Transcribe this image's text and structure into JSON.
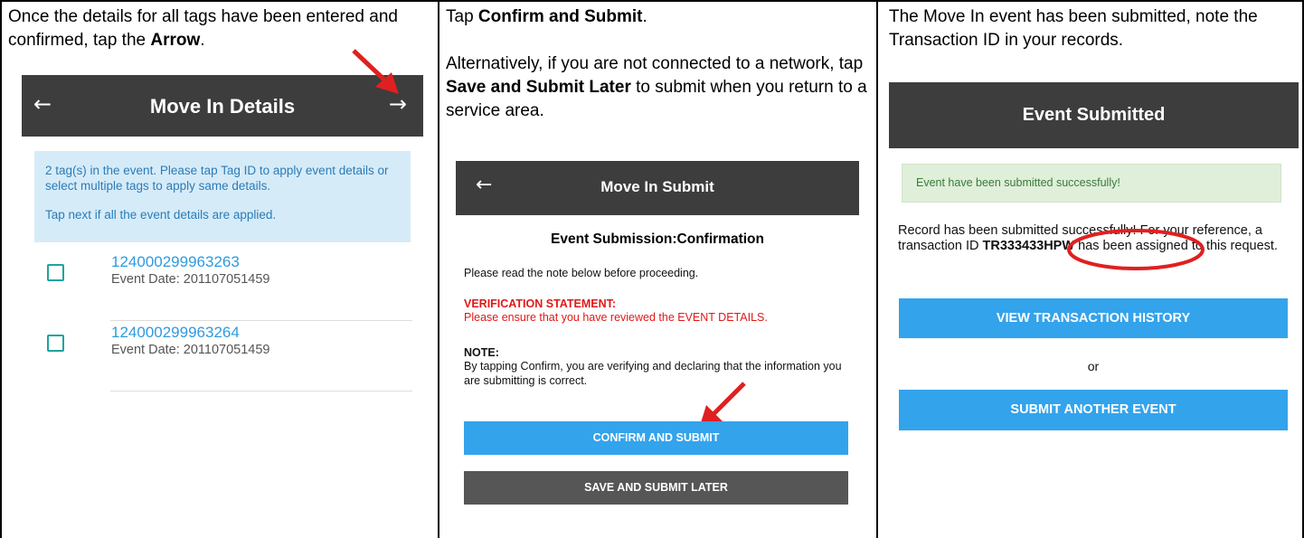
{
  "panel1": {
    "instruction_pre": "Once the details for all tags have been entered and confirmed, tap the ",
    "instruction_bold": "Arrow",
    "instruction_post": ".",
    "screen_title": "Move In Details",
    "back_icon": "arrow-left-icon",
    "next_icon": "arrow-right-icon",
    "info_line1": "2 tag(s) in the event. Please tap Tag ID to apply event details or select multiple tags to apply same details.",
    "info_line2": "Tap next if all the event details are applied.",
    "tags": [
      {
        "id": "124000299963263",
        "date": "Event Date: 201107051459"
      },
      {
        "id": "124000299963264",
        "date": "Event Date: 201107051459"
      }
    ]
  },
  "panel2": {
    "instruction1_pre": "Tap ",
    "instruction1_bold": "Confirm and Submit",
    "instruction1_post": ".",
    "instruction2_pre": "Alternatively, if you are not connected to a network, tap ",
    "instruction2_bold": "Save and Submit Later",
    "instruction2_post": " to submit when you return to a service area.",
    "screen_title": "Move In Submit",
    "back_icon": "arrow-left-icon",
    "heading": "Event Submission:Confirmation",
    "note_intro": "Please read the note below before proceeding.",
    "verification_title": "VERIFICATION STATEMENT:",
    "verification_text": "Please ensure that you have reviewed the EVENT DETAILS.",
    "note_title": "NOTE:",
    "note_text": "By tapping Confirm, you are verifying and declaring that the information you are submitting is correct.",
    "confirm_button": "CONFIRM AND SUBMIT",
    "save_button": "SAVE AND SUBMIT LATER"
  },
  "panel3": {
    "instruction": "The Move In event has been submitted, note the Transaction ID in your records.",
    "screen_title": "Event Submitted",
    "success_message": "Event have been submitted successfully!",
    "record_text_pre": "Record has been submitted successfully! For your reference, a transaction ID ",
    "transaction_id": "TR333433HPW",
    "record_text_post": " has been assigned to this request.",
    "history_button": "VIEW TRANSACTION HISTORY",
    "or_text": "or",
    "another_button": "SUBMIT ANOTHER EVENT"
  },
  "colors": {
    "appbar": "#3d3d3d",
    "accent_blue": "#33a3ec",
    "annotation_red": "#e02020",
    "info_bg": "#d6ebf8",
    "success_bg": "#dfefd9"
  }
}
